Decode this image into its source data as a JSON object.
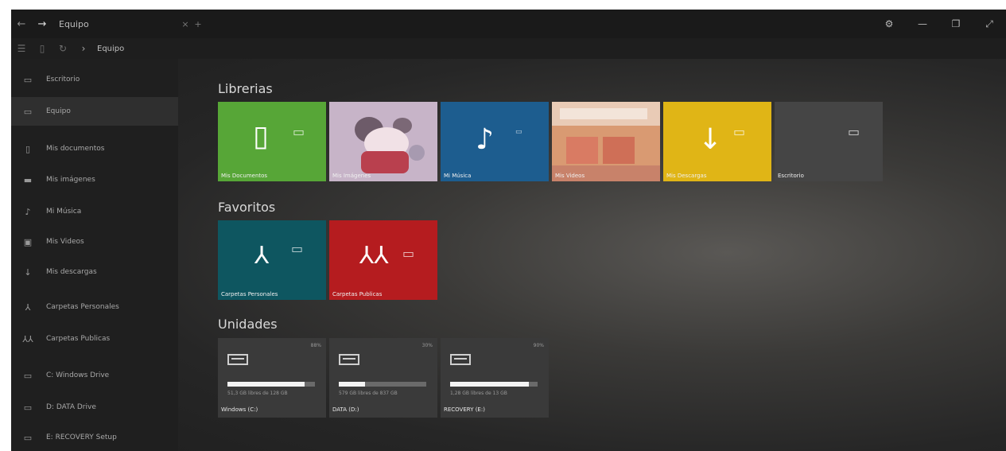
{
  "titlebar": {
    "back_icon": "back-arrow-icon",
    "forward_icon": "forward-arrow-icon",
    "title": "Equipo",
    "tab_close": "×",
    "tab_add": "+",
    "settings_icon": "gear-icon",
    "minimize": "—",
    "maximize": "❐",
    "more": "⤢"
  },
  "toolbar": {
    "breadcrumb_sep": "›",
    "breadcrumb": "Equipo"
  },
  "sidebar": {
    "items": [
      {
        "label": "Escritorio",
        "icon": "▭"
      },
      {
        "label": "Equipo",
        "icon": "▭"
      },
      {
        "label": "Mis documentos",
        "icon": "▯"
      },
      {
        "label": "Mis imágenes",
        "icon": "▬"
      },
      {
        "label": "Mi Música",
        "icon": "♪"
      },
      {
        "label": "Mis Videos",
        "icon": "▣"
      },
      {
        "label": "Mis descargas",
        "icon": "↓"
      },
      {
        "label": "Carpetas Personales",
        "icon": "⅄"
      },
      {
        "label": "Carpetas Publicas",
        "icon": "⅄⅄"
      },
      {
        "label": "C: Windows Drive",
        "icon": "▭"
      },
      {
        "label": "D: DATA Drive",
        "icon": "▭"
      },
      {
        "label": "E: RECOVERY Setup",
        "icon": "▭"
      }
    ]
  },
  "sections": {
    "libraries": "Librerias",
    "favorites": "Favoritos",
    "drives": "Unidades"
  },
  "libraries": [
    {
      "label": "Mis Documentos",
      "color": "#57a637"
    },
    {
      "label": "Mis Imágenes",
      "color": "#c7b4c8"
    },
    {
      "label": "Mi Música",
      "color": "#1d5d8f"
    },
    {
      "label": "Mis Videos",
      "color": "#d99a72"
    },
    {
      "label": "Mis Descargas",
      "color": "#e0b516"
    },
    {
      "label": "Escritorio",
      "color": "#454545"
    }
  ],
  "favorites": [
    {
      "label": "Carpetas Personales",
      "color": "#0e5660"
    },
    {
      "label": "Carpetas Publicas",
      "color": "#b51c1f"
    }
  ],
  "drives": [
    {
      "name": "Windows (C:)",
      "used_percent": 88,
      "free_text": "51,3 GB libres de 128 GB",
      "pct_label": "88%"
    },
    {
      "name": "DATA (D:)",
      "used_percent": 30,
      "free_text": "579 GB libres de 837 GB",
      "pct_label": "30%"
    },
    {
      "name": "RECOVERY (E:)",
      "used_percent": 90,
      "free_text": "1,28 GB libres de 13 GB",
      "pct_label": "90%"
    }
  ]
}
